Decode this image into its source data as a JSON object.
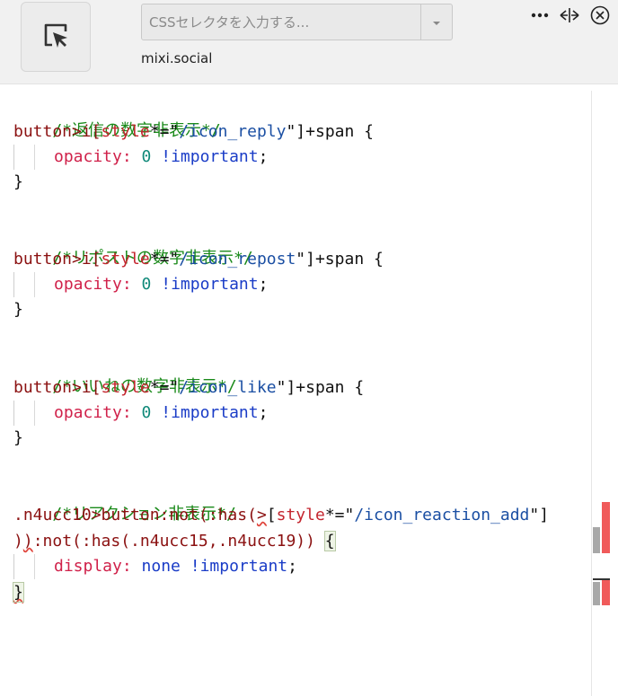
{
  "toolbar": {
    "selector_placeholder": "CSSセレクタを入力する...",
    "host": "mixi.social"
  },
  "icons": {
    "picker": "cursor-select-icon",
    "dropdown": "chevron-down-icon",
    "more": "more-horizontal-icon",
    "width": "resize-horizontal-icon",
    "close": "close-circle-icon"
  },
  "code": {
    "block1": {
      "comment": "/*返信の数字非表示*/",
      "sel_tag": "button>i[",
      "sel_attr": "style",
      "sel_op": "*=\"",
      "sel_str": "/icon_reply",
      "sel_end": "\"]+span {",
      "prop": "opacity",
      "colon": ":",
      "val": "0",
      "imp": "!important",
      "semi": ";",
      "close": "}"
    },
    "block2": {
      "comment": "/*リポストの数字非表示*/",
      "sel_tag": "button>i[",
      "sel_attr": "style",
      "sel_op": "*=\"",
      "sel_str": "/icon_repost",
      "sel_end": "\"]+span {",
      "prop": "opacity",
      "colon": ":",
      "val": "0",
      "imp": "!important",
      "semi": ";",
      "close": "}"
    },
    "block3": {
      "comment": "/*いいねの数字非表示*/",
      "sel_tag": "button>i[",
      "sel_attr": "style",
      "sel_op": "*=\"",
      "sel_str": "/icon_like",
      "sel_end": "\"]+span {",
      "prop": "opacity",
      "colon": ":",
      "val": "0",
      "imp": "!important",
      "semi": ";",
      "close": "}"
    },
    "block4": {
      "comment": "/*リアクション非表示*/",
      "line1_a": ".n4ucc10>button:not(:has(",
      "line1_sq": ">",
      "line1_b": "[",
      "line1_attr": "style",
      "line1_op": "*=\"",
      "line1_str": "/icon_reaction_add",
      "line1_end": "\"]",
      "line2_a": ")",
      "line2_sq": ")",
      "line2_b": ":not(:has(.n4ucc15,.n4ucc19)) ",
      "line2_brace": "{",
      "prop": "display",
      "colon": ":",
      "val": "none",
      "imp": "!important",
      "semi": ";",
      "close": "}"
    }
  },
  "scrollbar": {
    "error_color": "#f05a5a",
    "thumb_color": "#a8a8a8"
  }
}
